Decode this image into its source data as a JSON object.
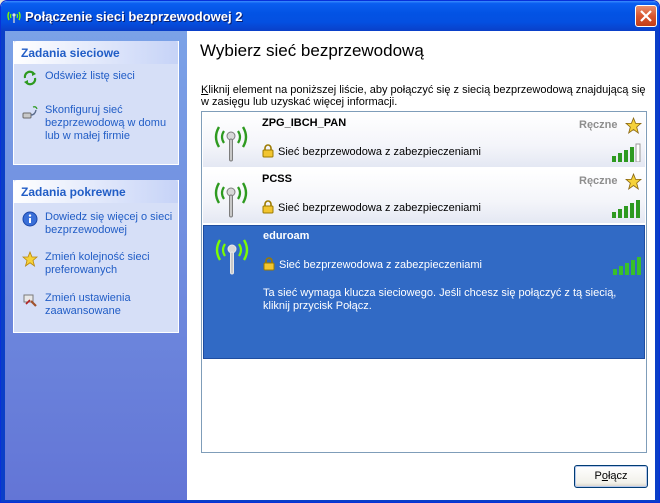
{
  "window": {
    "title": "Połączenie sieci bezprzewodowej 2"
  },
  "sidebar": {
    "network_tasks": {
      "heading": "Zadania sieciowe",
      "items": [
        {
          "icon": "refresh-icon",
          "label": "Odśwież listę sieci"
        },
        {
          "icon": "setup-network-icon",
          "label": "Skonfiguruj sieć bezprzewodową w domu lub w małej firmie"
        }
      ]
    },
    "related_tasks": {
      "heading": "Zadania pokrewne",
      "items": [
        {
          "icon": "info-icon",
          "label": "Dowiedz się więcej o sieci bezprzewodowej"
        },
        {
          "icon": "star-icon",
          "label": "Zmień kolejność sieci preferowanych"
        },
        {
          "icon": "settings-icon",
          "label": "Zmień ustawienia zaawansowane"
        }
      ]
    }
  },
  "main": {
    "title": "Wybierz sieć bezprzewodową",
    "hint_first_letter": "K",
    "hint_rest": "liknij element na poniższej liście, aby połączyć się z siecią bezprzewodową znajdującą się w zasięgu lub uzyskać więcej informacji.",
    "networks": [
      {
        "ssid": "ZPG_IBCH_PAN",
        "mode": "Ręczne",
        "security": "Sieć bezprzewodowa z zabezpieczeniami",
        "signal_bars": 4,
        "preferred": true
      },
      {
        "ssid": "PCSS",
        "mode": "Ręczne",
        "security": "Sieć bezprzewodowa z zabezpieczeniami",
        "signal_bars": 5,
        "preferred": true
      },
      {
        "ssid": "eduroam",
        "mode": "",
        "security": "Sieć bezprzewodowa z zabezpieczeniami",
        "signal_bars": 5,
        "preferred": false,
        "selected": true,
        "detail": "Ta sieć wymaga klucza sieciowego. Jeśli chcesz się połączyć z tą siecią, kliknij przycisk Połącz."
      }
    ],
    "connect_button_pre": "P",
    "connect_button_u": "o",
    "connect_button_post": "łącz"
  },
  "colors": {
    "titlebar": "#0353E4",
    "sidepane": "#7BA2E7",
    "task_link": "#215DC6",
    "selection": "#316AC5",
    "signal_green": "#2E9A20"
  }
}
